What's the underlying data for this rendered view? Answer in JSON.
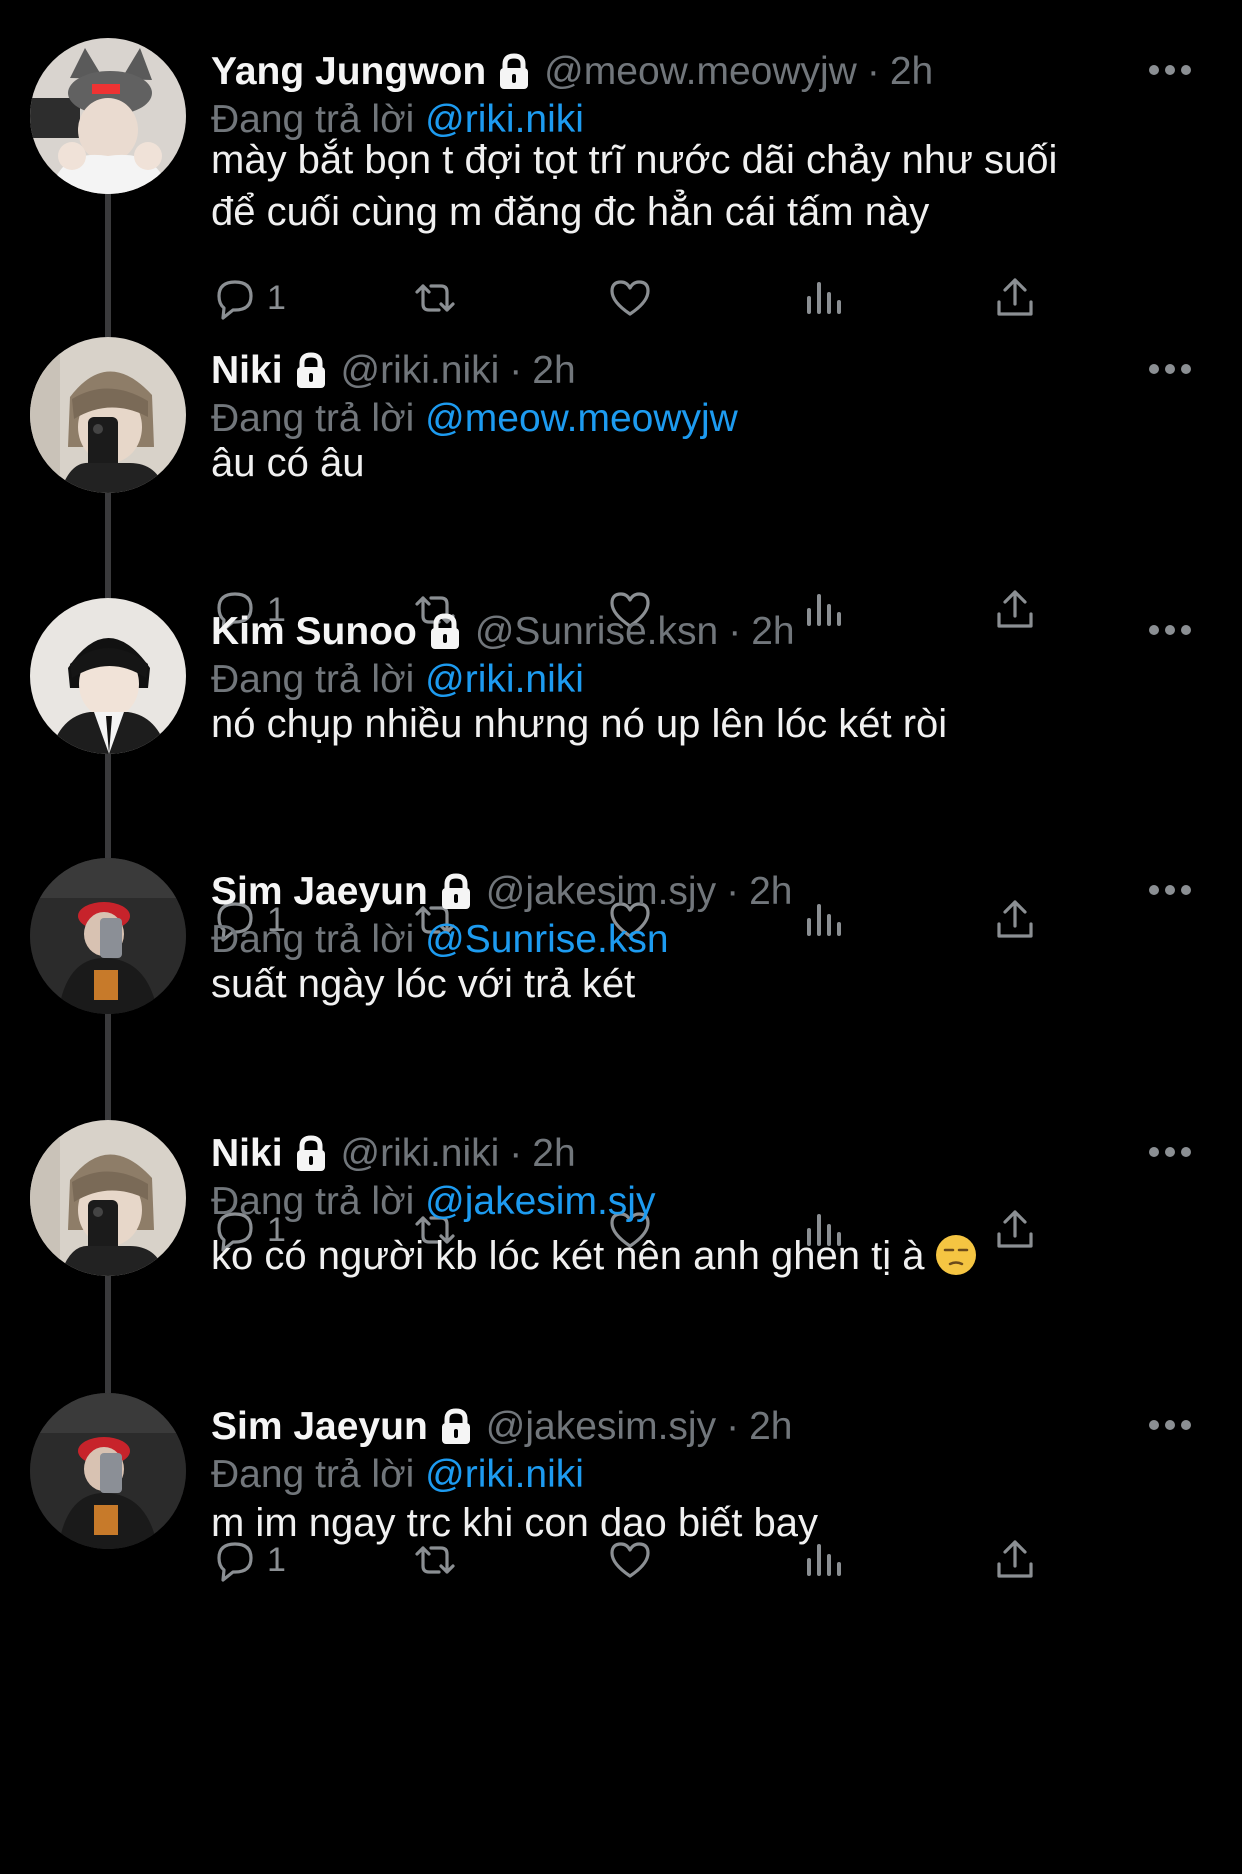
{
  "labels": {
    "replying_to": "Đang trả lời"
  },
  "tweets": [
    {
      "name": "Yang Jungwon",
      "handle": "@meow.meowyjw",
      "sep": "·",
      "time": "2h",
      "replying_to": "@riki.niki",
      "text": [
        "mày bắt bọn t đợi tọt trĩ nước dãi chảy như suối",
        "để cuối cùng m đăng đc hẳn cái tấm này"
      ],
      "reply_count": "1",
      "avatar": "avatar-cat-beanie"
    },
    {
      "name": "Niki",
      "handle": "@riki.niki",
      "sep": "·",
      "time": "2h",
      "replying_to": "@meow.meowyjw",
      "text": [
        "âu có âu"
      ],
      "reply_count": "1",
      "avatar": "avatar-mirror-selfie"
    },
    {
      "name": "Kim Sunoo",
      "handle": "@Sunrise.ksn",
      "sep": "·",
      "time": "2h",
      "replying_to": "@riki.niki",
      "text": [
        "nó chụp nhiều nhưng nó up lên lóc két ròi"
      ],
      "reply_count": "1",
      "avatar": "avatar-suit"
    },
    {
      "name": "Sim Jaeyun",
      "handle": "@jakesim.sjy",
      "sep": "·",
      "time": "2h",
      "replying_to": "@Sunrise.ksn",
      "text": [
        "suất ngày lóc với trả két"
      ],
      "reply_count": "1",
      "avatar": "avatar-red-cap"
    },
    {
      "name": "Niki",
      "handle": "@riki.niki",
      "sep": "·",
      "time": "2h",
      "replying_to": "@jakesim.sjy",
      "text": [
        "ko có người kb lóc két nên anh ghen tị à"
      ],
      "emoji": "unamused-face",
      "reply_count": "1",
      "avatar": "avatar-mirror-selfie"
    },
    {
      "name": "Sim Jaeyun",
      "handle": "@jakesim.sjy",
      "sep": "·",
      "time": "2h",
      "replying_to": "@riki.niki",
      "text": [
        "m im ngay trc khi con dao biết bay"
      ],
      "reply_count": "",
      "avatar": "avatar-red-cap"
    }
  ],
  "icons": {
    "reply": "reply-icon",
    "retweet": "retweet-icon",
    "like": "heart-icon",
    "views": "views-icon",
    "share": "share-icon",
    "more": "more-icon",
    "lock": "lock-icon"
  },
  "colors": {
    "background": "#000000",
    "link": "#1d9bf0",
    "muted": "#71767b",
    "thread_line": "#3a3a3c"
  }
}
